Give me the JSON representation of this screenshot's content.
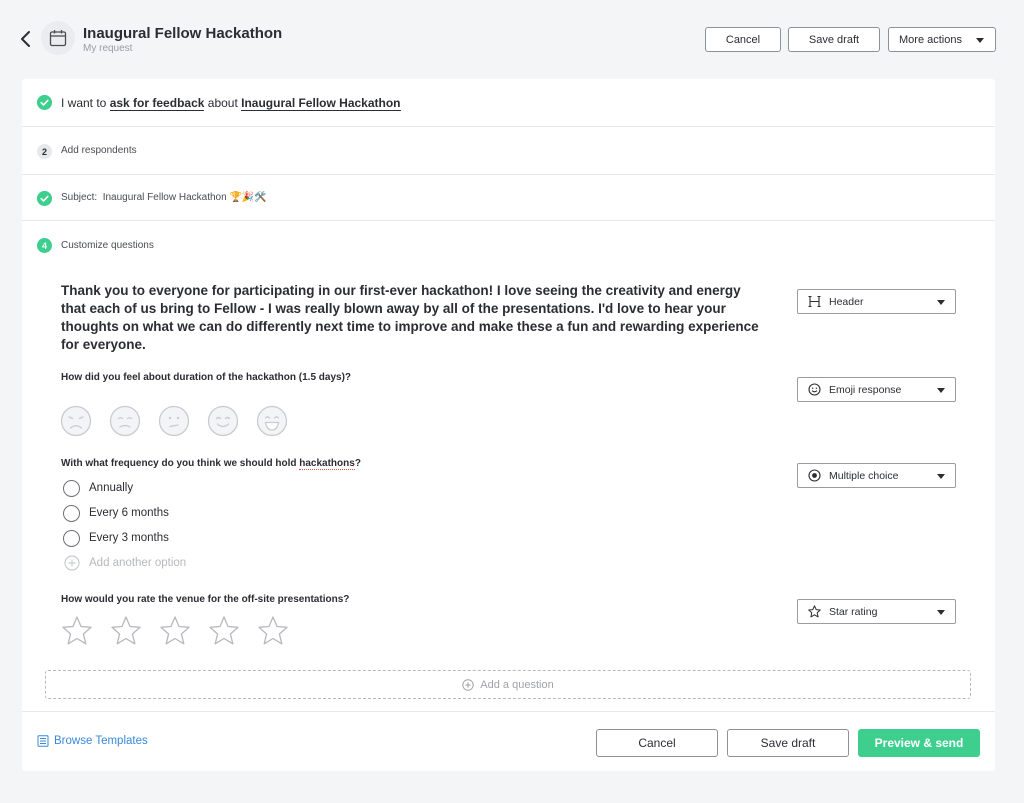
{
  "header": {
    "title": "Inaugural Fellow Hackathon",
    "subtitle": "My request",
    "cancel_label": "Cancel",
    "save_draft_label": "Save draft",
    "more_actions_label": "More actions"
  },
  "steps": {
    "s1": {
      "prefix": "I want to",
      "action": "ask for feedback",
      "middle": "about",
      "target": "Inaugural Fellow Hackathon"
    },
    "s2": {
      "number": "2",
      "label": "Add respondents"
    },
    "s3": {
      "label": "Subject:",
      "value": "Inaugural Fellow Hackathon 🏆🎉🛠️"
    },
    "s4": {
      "number": "4",
      "label": "Customize questions"
    }
  },
  "questions": {
    "intro": "Thank you to everyone for participating in our first-ever hackathon! I love seeing the creativity and energy that each of us bring to Fellow - I was really blown away by all of the presentations. I'd love to hear your thoughts on what we can do differently next time to improve and make these a fun and rewarding experience for everyone.",
    "q1": "How did you feel about duration of the hackathon (1.5 days)?",
    "q2_before": "With what frequency do you think we should hold ",
    "q2_word": "hackathons",
    "q2_after": "?",
    "options": [
      "Annually",
      "Every 6 months",
      "Every 3 months"
    ],
    "add_option": "Add another option",
    "q3": "How would you rate the venue for the off-site presentations?",
    "add_question": "Add a question"
  },
  "type_dropdowns": {
    "header": "Header",
    "emoji": "Emoji response",
    "multiple": "Multiple choice",
    "star": "Star rating"
  },
  "footer": {
    "browse_templates": "Browse Templates",
    "cancel_label": "Cancel",
    "save_draft_label": "Save draft",
    "preview_send_label": "Preview & send"
  },
  "colors": {
    "accent": "#3ecf8e",
    "link": "#3a88d8",
    "background": "#f4f5f7"
  },
  "icons": {
    "back": "chevron-left-icon",
    "calendar": "calendar-icon",
    "check": "check-circle-icon",
    "heading": "heading-icon",
    "emoji": "smiley-icon",
    "radio": "radio-icon",
    "star": "star-icon",
    "plus": "plus-circle-icon",
    "templates": "document-list-icon"
  }
}
